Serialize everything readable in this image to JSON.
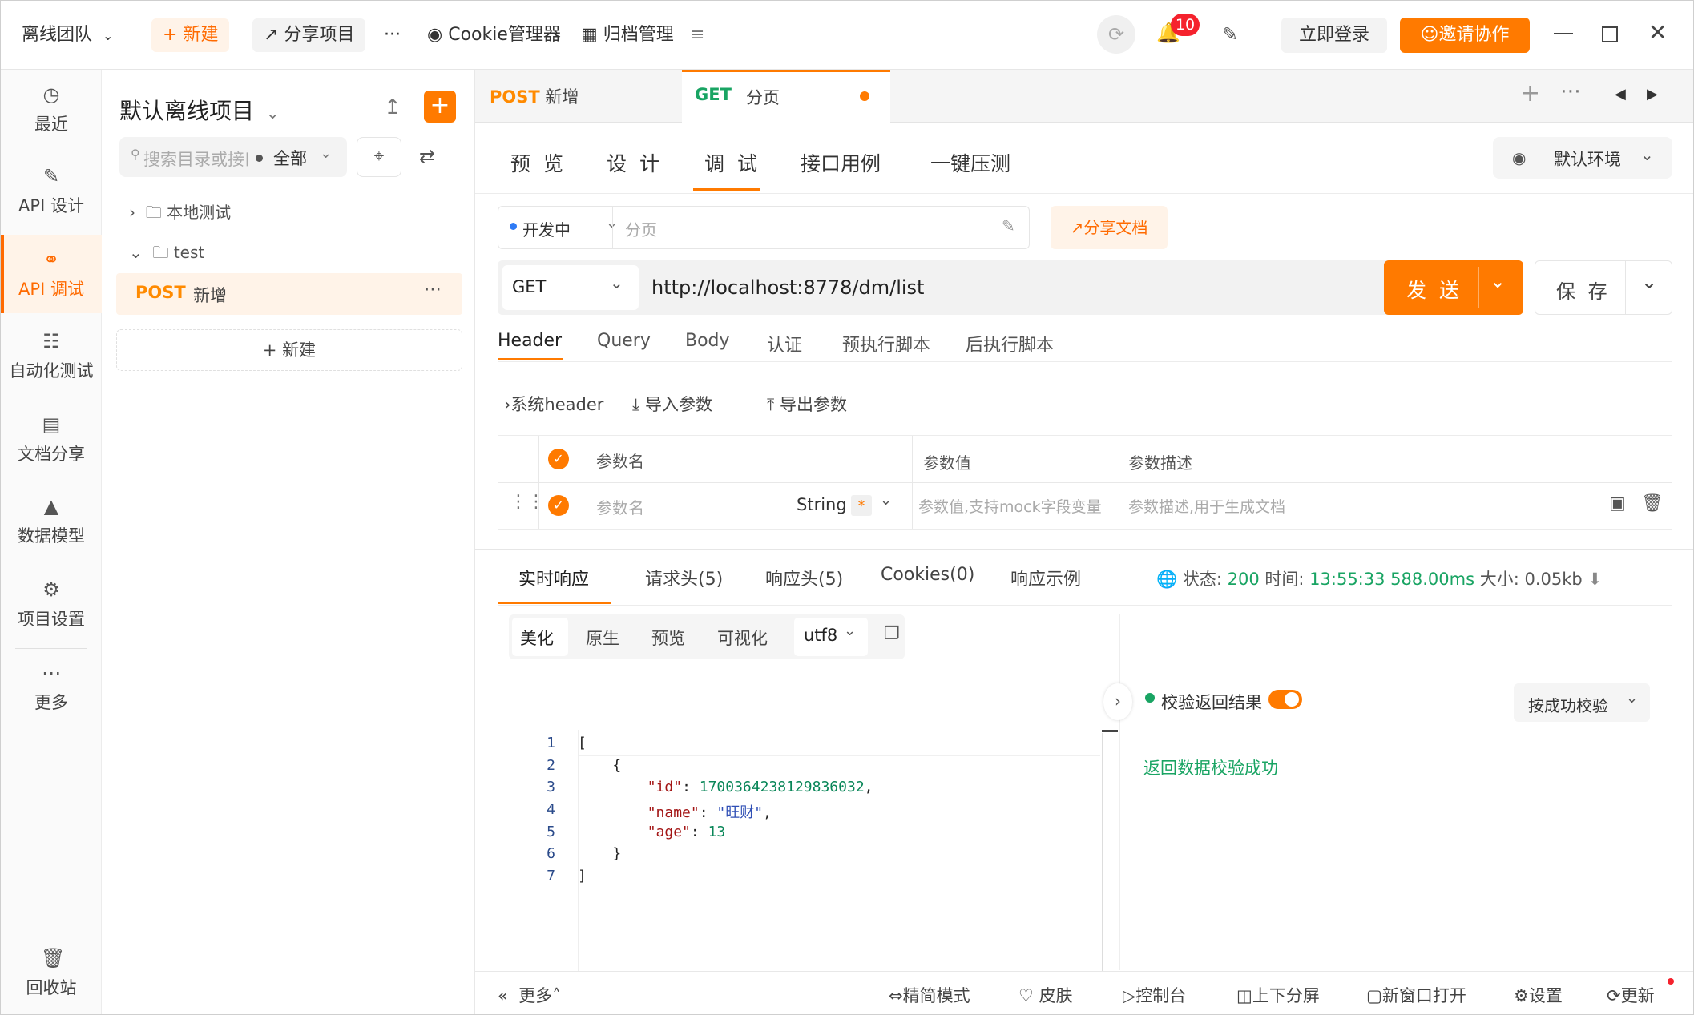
{
  "topbar": {
    "team": "离线团队",
    "new_label": "新建",
    "share_project": "分享项目",
    "more": "···",
    "cookie_manager": "Cookie管理器",
    "archive": "归档管理",
    "notif_count": "10",
    "login": "立即登录",
    "invite": "邀请协作"
  },
  "leftnav": {
    "items": [
      {
        "label": "最近",
        "icon": "clock-icon"
      },
      {
        "label": "API 设计",
        "icon": "edit-icon"
      },
      {
        "label": "API 调试",
        "icon": "link-icon"
      },
      {
        "label": "自动化测试",
        "icon": "flow-icon"
      },
      {
        "label": "文档分享",
        "icon": "doc-icon"
      },
      {
        "label": "数据模型",
        "icon": "model-icon"
      },
      {
        "label": "项目设置",
        "icon": "folder-gear-icon"
      },
      {
        "label": "更多",
        "icon": "dots-icon"
      }
    ],
    "trash": "回收站"
  },
  "tree": {
    "project": "默认离线项目",
    "search_placeholder": "搜索目录或接口",
    "filter": "全部",
    "folders": [
      "本地测试",
      "test"
    ],
    "item_method": "POST",
    "item_name": "新增",
    "new_label": "新建"
  },
  "tabs": [
    {
      "method": "POST",
      "name": "新增"
    },
    {
      "method": "GET",
      "name": "分页"
    }
  ],
  "subtabs": [
    "预 览",
    "设 计",
    "调 试",
    "接口用例",
    "一键压测"
  ],
  "env": "默认环境",
  "request": {
    "status": "开发中",
    "name_placeholder": "分页",
    "share_doc": "分享文档",
    "method": "GET",
    "url": "http://localhost:8778/dm/list",
    "send": "发 送",
    "save": "保 存"
  },
  "param_tabs": [
    "Header",
    "Query",
    "Body",
    "认证",
    "预执行脚本",
    "后执行脚本"
  ],
  "param_actions": [
    "系统header",
    "导入参数",
    "导出参数"
  ],
  "param_table": {
    "headers": [
      "参数名",
      "参数值",
      "参数描述"
    ],
    "row": {
      "name_placeholder": "参数名",
      "type": "String",
      "required": "*",
      "value_placeholder": "参数值,支持mock字段变量",
      "desc_placeholder": "参数描述,用于生成文档"
    }
  },
  "response": {
    "tabs": [
      "实时响应",
      "请求头(5)",
      "响应头(5)",
      "Cookies(0)",
      "响应示例"
    ],
    "status_label": "状态:",
    "status": "200",
    "time_label": "时间:",
    "time": "13:55:33",
    "duration": "588.00ms",
    "size_label": "大小:",
    "size": "0.05kb",
    "view_modes": [
      "美化",
      "原生",
      "预览",
      "可视化"
    ],
    "encoding": "utf8",
    "validate_label": "校验返回结果",
    "validate_mode": "按成功校验",
    "validate_result": "返回数据校验成功",
    "code_lines": [
      "[",
      "    {",
      "        \"id\": 1700364238129836032,",
      "        \"name\": \"旺财\",",
      "        \"age\": 13",
      "    }",
      "]"
    ]
  },
  "bottombar": [
    "更多",
    "精简模式",
    "皮肤",
    "控制台",
    "上下分屏",
    "新窗口打开",
    "设置",
    "更新"
  ]
}
